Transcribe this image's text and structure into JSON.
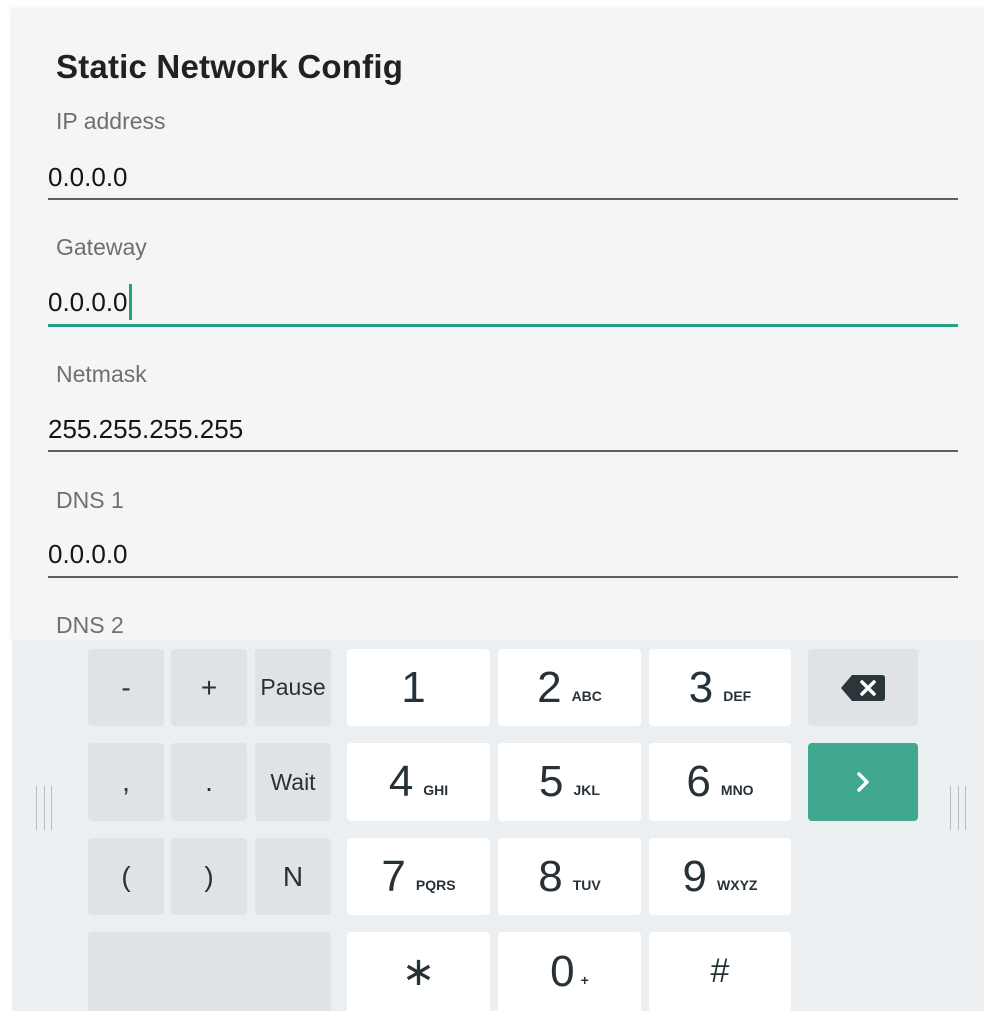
{
  "dialog": {
    "title": "Static Network Config",
    "fields": [
      {
        "label": "IP address",
        "value": "0.0.0.0"
      },
      {
        "label": "Gateway",
        "value": "0.0.0.0"
      },
      {
        "label": "Netmask",
        "value": "255.255.255.255"
      },
      {
        "label": "DNS 1",
        "value": "0.0.0.0"
      },
      {
        "label": "DNS 2",
        "value": ""
      }
    ]
  },
  "keyboard": {
    "symbols": {
      "minus": "-",
      "plus": "+",
      "pause": "Pause",
      "comma": ",",
      "period": ".",
      "wait": "Wait",
      "open_paren": "(",
      "close_paren": ")",
      "n": "N"
    },
    "digits": [
      {
        "digit": "1",
        "letters": ""
      },
      {
        "digit": "2",
        "letters": "ABC"
      },
      {
        "digit": "3",
        "letters": "DEF"
      },
      {
        "digit": "4",
        "letters": "GHI"
      },
      {
        "digit": "5",
        "letters": "JKL"
      },
      {
        "digit": "6",
        "letters": "MNO"
      },
      {
        "digit": "7",
        "letters": "PQRS"
      },
      {
        "digit": "8",
        "letters": "TUV"
      },
      {
        "digit": "9",
        "letters": "WXYZ"
      },
      {
        "digit": "0",
        "letters": "+"
      }
    ],
    "star": "∗",
    "hash": "#",
    "icons": {
      "delete": "backspace-icon",
      "next": "chevron-right-icon"
    },
    "accent_color": "#3fa88e"
  }
}
